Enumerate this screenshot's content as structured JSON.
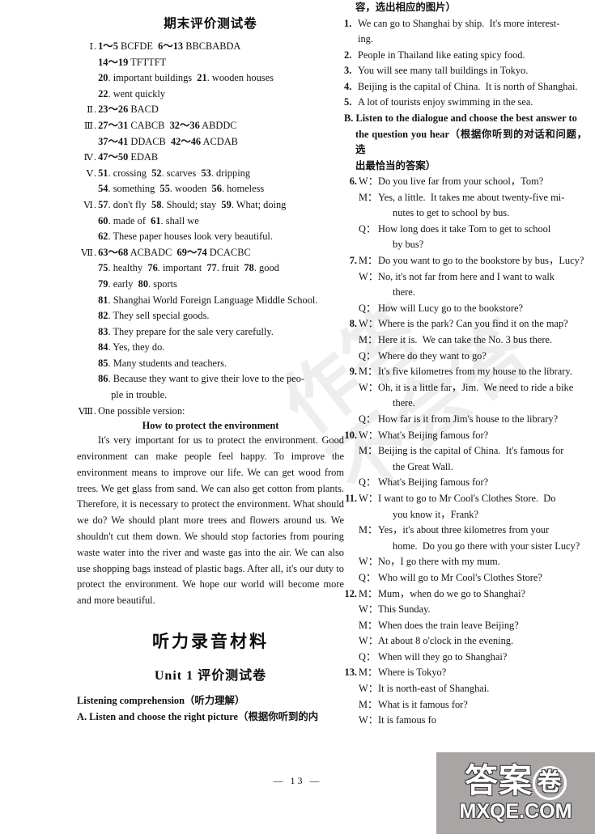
{
  "page": {
    "number_label": "— 13 —"
  },
  "watermark": {
    "diagonal_text": "作答\n不会答",
    "logo_cn_left": "答案",
    "logo_cn_circled": "卷",
    "logo_domain": "MXQE.COM"
  },
  "left_column": {
    "exam_title": "期末评价测试卷",
    "answers": [
      {
        "roman": "Ⅰ",
        "text": "1～5 BCFDE  6～13 BBCBABDA",
        "bold_parts": [
          "1～5",
          "6～13"
        ],
        "indent": 0
      },
      {
        "roman": "",
        "text": "14～19 TFTTFT",
        "indent": 1
      },
      {
        "roman": "",
        "text": "20. important buildings  21. wooden houses",
        "indent": 1
      },
      {
        "roman": "",
        "text": "22. went quickly",
        "indent": 1
      },
      {
        "roman": "Ⅱ",
        "text": "23～26 BACD",
        "indent": 0
      },
      {
        "roman": "Ⅲ",
        "text": "27～31 CABCB  32～36 ABDDC",
        "indent": 0
      },
      {
        "roman": "",
        "text": "37～41 DDACB  42～46 ACDAB",
        "indent": 1
      },
      {
        "roman": "Ⅳ",
        "text": "47～50 EDAB",
        "indent": 0
      },
      {
        "roman": "Ⅴ",
        "text": "51. crossing  52. scarves  53. dripping",
        "indent": 0
      },
      {
        "roman": "",
        "text": "54. something  55. wooden  56. homeless",
        "indent": 1
      },
      {
        "roman": "Ⅵ",
        "text": "57. don't fly  58. Should; stay  59. What; doing",
        "indent": 0
      },
      {
        "roman": "",
        "text": "60. made of  61. shall we",
        "indent": 1
      },
      {
        "roman": "",
        "text": "62. These paper houses look very beautiful.",
        "indent": 1
      },
      {
        "roman": "Ⅶ",
        "text": "63～68 ACBADC  69～74 DCACBC",
        "indent": 0
      },
      {
        "roman": "",
        "text": "75. healthy  76. important  77. fruit  78. good",
        "indent": 1
      },
      {
        "roman": "",
        "text": "79. early  80. sports",
        "indent": 1
      },
      {
        "roman": "",
        "text": "81. Shanghai World Foreign Language Middle School.",
        "indent": 1
      },
      {
        "roman": "",
        "text": "82. They sell special goods.",
        "indent": 1
      },
      {
        "roman": "",
        "text": "83. They prepare for the sale very carefully.",
        "indent": 1
      },
      {
        "roman": "",
        "text": "84. Yes, they do.",
        "indent": 1
      },
      {
        "roman": "",
        "text": "85. Many students and teachers.",
        "indent": 1
      },
      {
        "roman": "",
        "text": "86. Because they want to give their love to the peo-",
        "indent": 1
      },
      {
        "roman": "",
        "text": "ple in trouble.",
        "indent": 2
      },
      {
        "roman": "Ⅷ",
        "text": "One possible version:",
        "indent": 0
      }
    ],
    "essay": {
      "title": "How to protect the environment",
      "body": "It's very important for us to protect the environment. Good environment can make people feel happy. To improve the environment means to improve our life. We can get wood from trees. We get glass from sand. We can also get cotton from plants. Therefore, it is necessary to protect the environment. What should we do? We should plant more trees and flowers around us. We shouldn't cut them down. We should stop factories from pouring waste water into the river and waste gas into the air. We can also use shopping bags instead of plastic bags. After all, it's our duty to protect the environment. We hope our world will become more and more beautiful."
    },
    "audio_section_title": "听力录音材料",
    "unit_title": "Unit 1 评价测试卷",
    "listening_heading": "Listening comprehension（听力理解）",
    "part_a_heading": "A. Listen and choose the right picture（根据你听到的内"
  },
  "right_column": {
    "part_a_heading_cont": "容，选出相应的图片）",
    "part_a_items": [
      {
        "n": "1.",
        "lines": [
          "We can go to Shanghai by ship.  It's more interest-",
          "ing."
        ]
      },
      {
        "n": "2.",
        "lines": [
          "People in Thailand like eating spicy food."
        ]
      },
      {
        "n": "3.",
        "lines": [
          "You will see many tall buildings in Tokyo."
        ]
      },
      {
        "n": "4.",
        "lines": [
          "Beijing is the capital of China.  It is north of Shanghai."
        ]
      },
      {
        "n": "5.",
        "lines": [
          "A lot of tourists enjoy swimming in the sea."
        ]
      }
    ],
    "part_b_heading_line1": "B. Listen to the dialogue and choose the best answer to",
    "part_b_heading_line2": "the question you hear（根据你听到的对话和问题，选",
    "part_b_heading_line3": "出最恰当的答案）",
    "dialogues": [
      {
        "n": "6.",
        "turns": [
          {
            "speaker": "W：",
            "lines": [
              "Do you live far from your school，Tom?"
            ]
          },
          {
            "speaker": "M：",
            "lines": [
              "Yes, a little.  It takes me about twenty-five mi-",
              "nutes to get to school by bus."
            ]
          },
          {
            "speaker": "Q：",
            "lines": [
              "How long does it take Tom to get to school",
              "by bus?"
            ]
          }
        ]
      },
      {
        "n": "7.",
        "turns": [
          {
            "speaker": "M：",
            "lines": [
              "Do you want to go to the bookstore by bus，Lucy?"
            ]
          },
          {
            "speaker": "W：",
            "lines": [
              "No, it's not far from here and I want to walk",
              "there."
            ]
          },
          {
            "speaker": "Q：",
            "lines": [
              "How will Lucy go to the bookstore?"
            ]
          }
        ]
      },
      {
        "n": "8.",
        "turns": [
          {
            "speaker": "W：",
            "lines": [
              "Where is the park? Can you find it on the map?"
            ]
          },
          {
            "speaker": "M：",
            "lines": [
              "Here it is.  We can take the No. 3 bus there."
            ]
          },
          {
            "speaker": "Q：",
            "lines": [
              "Where do they want to go?"
            ]
          }
        ]
      },
      {
        "n": "9.",
        "turns": [
          {
            "speaker": "M：",
            "lines": [
              "It's five kilometres from my house to the library."
            ]
          },
          {
            "speaker": "W：",
            "lines": [
              "Oh, it is a little far，Jim.  We need to ride a bike",
              "there."
            ]
          },
          {
            "speaker": "Q：",
            "lines": [
              "How far is it from Jim's house to the library?"
            ]
          }
        ]
      },
      {
        "n": "10.",
        "turns": [
          {
            "speaker": "W：",
            "lines": [
              "What's Beijing famous for?"
            ]
          },
          {
            "speaker": "M：",
            "lines": [
              "Beijing is the capital of China.  It's famous for",
              "the Great Wall."
            ]
          },
          {
            "speaker": "Q：",
            "lines": [
              "What's Beijing famous for?"
            ]
          }
        ]
      },
      {
        "n": "11.",
        "turns": [
          {
            "speaker": "W：",
            "lines": [
              "I want to go to Mr Cool's Clothes Store.  Do",
              "you know it，Frank?"
            ]
          },
          {
            "speaker": "M：",
            "lines": [
              "Yes，it's about three kilometres from your",
              "home.  Do you go there with your sister Lucy?"
            ]
          },
          {
            "speaker": "W：",
            "lines": [
              "No，I go there with my mum."
            ]
          },
          {
            "speaker": "Q：",
            "lines": [
              "Who will go to Mr Cool's Clothes Store?"
            ]
          }
        ]
      },
      {
        "n": "12.",
        "turns": [
          {
            "speaker": "M：",
            "lines": [
              "Mum，when do we go to Shanghai?"
            ]
          },
          {
            "speaker": "W：",
            "lines": [
              "This Sunday."
            ]
          },
          {
            "speaker": "M：",
            "lines": [
              "When does the train leave Beijing?"
            ]
          },
          {
            "speaker": "W：",
            "lines": [
              "At about 8 o'clock in the evening."
            ]
          },
          {
            "speaker": "Q：",
            "lines": [
              "When will they go to Shanghai?"
            ]
          }
        ]
      },
      {
        "n": "13.",
        "turns": [
          {
            "speaker": "M：",
            "lines": [
              "Where is Tokyo?"
            ]
          },
          {
            "speaker": "W：",
            "lines": [
              "It is north-east of Shanghai."
            ]
          },
          {
            "speaker": "M：",
            "lines": [
              "What is it famous for?"
            ]
          },
          {
            "speaker": "W：",
            "lines": [
              "It is famous fo"
            ]
          }
        ]
      }
    ]
  }
}
